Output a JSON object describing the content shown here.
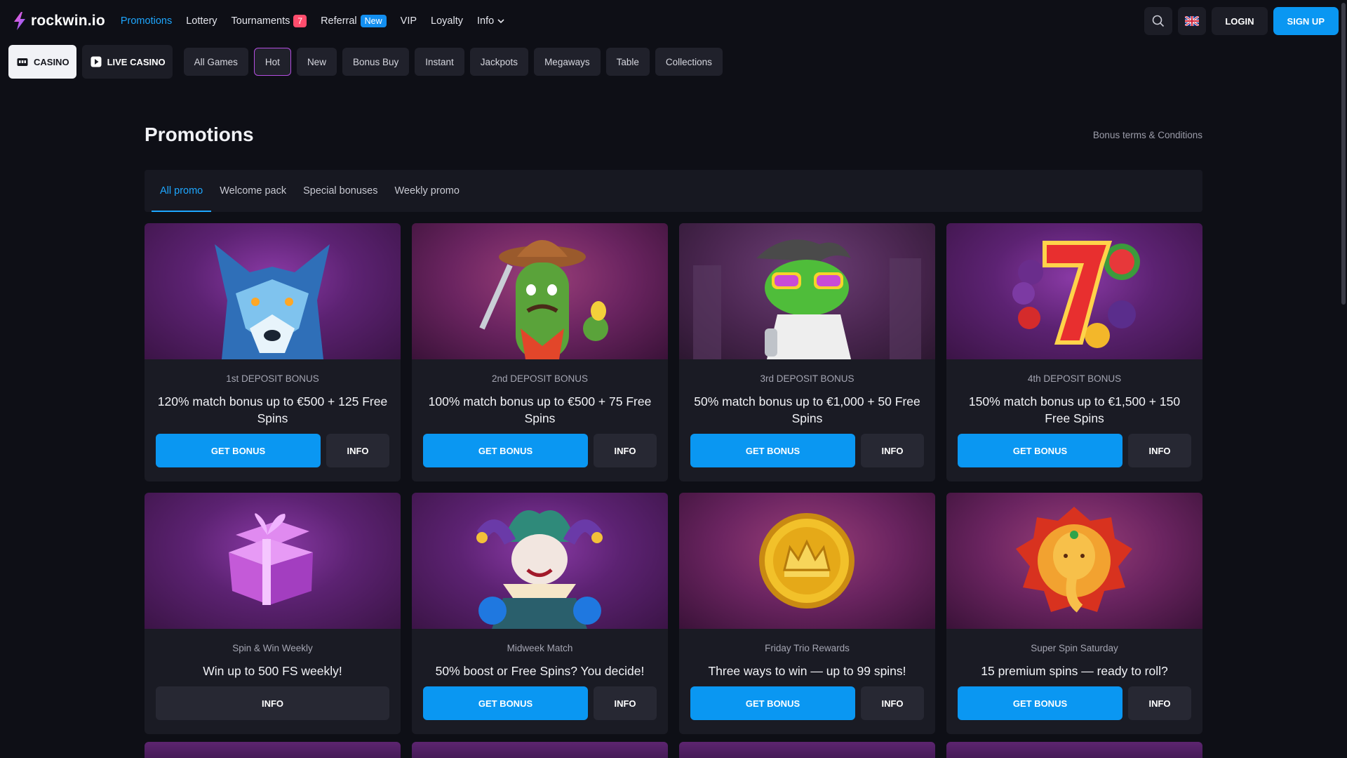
{
  "brand": {
    "name": "rockwin.io"
  },
  "topnav": {
    "items": [
      {
        "label": "Promotions",
        "active": true
      },
      {
        "label": "Lottery"
      },
      {
        "label": "Tournaments",
        "count": "7"
      },
      {
        "label": "Referral",
        "badge": "New"
      },
      {
        "label": "VIP"
      },
      {
        "label": "Loyalty"
      },
      {
        "label": "Info"
      }
    ],
    "login": "LOGIN",
    "signup": "SIGN UP",
    "search_icon": "search-icon",
    "language_icon": "uk-flag-icon"
  },
  "catbar": {
    "casino": "CASINO",
    "live_casino": "LIVE CASINO",
    "chips": [
      "All Games",
      "Hot",
      "New",
      "Bonus Buy",
      "Instant",
      "Jackpots",
      "Megaways",
      "Table",
      "Collections"
    ],
    "selected_chip": "Hot"
  },
  "page": {
    "title": "Promotions",
    "terms_link": "Bonus terms & Conditions",
    "tabs": [
      "All promo",
      "Welcome pack",
      "Special bonuses",
      "Weekly promo"
    ],
    "active_tab": "All promo"
  },
  "cards": [
    {
      "subtitle": "1st DEPOSIT BONUS",
      "title": "120% match bonus up to €500 + 125 Free Spins",
      "get": "GET BONUS",
      "info": "INFO",
      "art": "wolf"
    },
    {
      "subtitle": "2nd DEPOSIT BONUS",
      "title": "100% match bonus up to €500 + 75 Free Spins",
      "get": "GET BONUS",
      "info": "INFO",
      "art": "cactus-cowboy"
    },
    {
      "subtitle": "3rd DEPOSIT BONUS",
      "title": "50% match bonus up to €1,000 + 50 Free Spins",
      "get": "GET BONUS",
      "info": "INFO",
      "art": "frog-singer"
    },
    {
      "subtitle": "4th DEPOSIT BONUS",
      "title": "150% match bonus up to €1,500 + 150 Free Spins",
      "get": "GET BONUS",
      "info": "INFO",
      "art": "lucky-seven"
    },
    {
      "subtitle": "Spin & Win Weekly",
      "title": "Win up to 500 FS weekly!",
      "info": "INFO",
      "art": "gift-box"
    },
    {
      "subtitle": "Midweek Match",
      "title": "50% boost or Free Spins? You decide!",
      "get": "GET BONUS",
      "info": "INFO",
      "art": "jester"
    },
    {
      "subtitle": "Friday Trio Rewards",
      "title": "Three ways to win — up to 99 spins!",
      "get": "GET BONUS",
      "info": "INFO",
      "art": "gold-coin"
    },
    {
      "subtitle": "Super Spin Saturday",
      "title": "15 premium spins — ready to roll?",
      "get": "GET BONUS",
      "info": "INFO",
      "art": "elephant"
    }
  ],
  "colors": {
    "accent": "#0a97f2",
    "active_link": "#1ea7ff",
    "background": "#0e0f16",
    "card": "#1a1b24"
  }
}
